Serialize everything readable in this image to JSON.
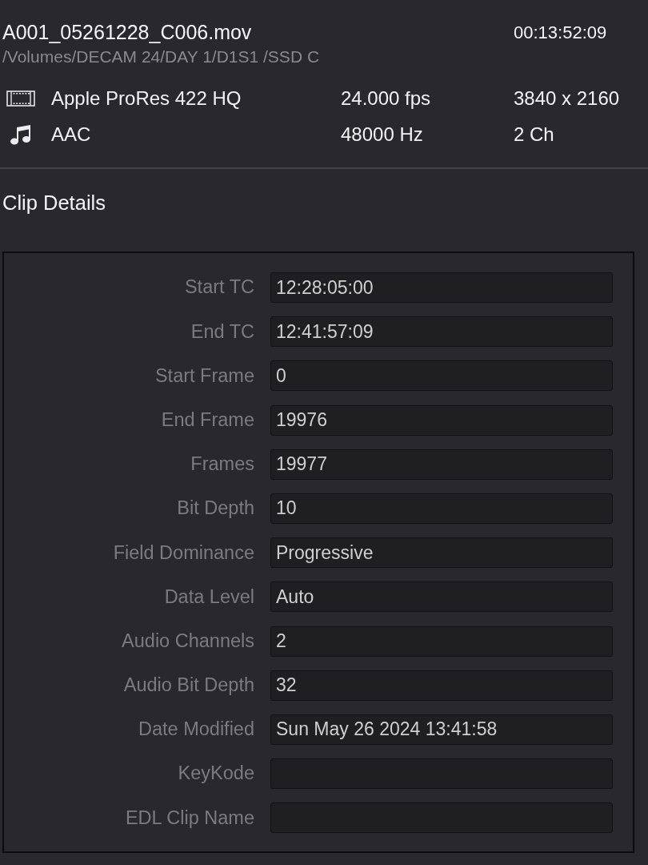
{
  "clip": {
    "filename": "A001_05261228_C006.mov",
    "duration": "00:13:52:09",
    "path": "/Volumes/DECAM 24/DAY 1/D1S1 /SSD C"
  },
  "streams": [
    {
      "kind": "video",
      "codec": "Apple ProRes 422 HQ",
      "rate": "24.000 fps",
      "format": "3840 x 2160"
    },
    {
      "kind": "audio",
      "codec": "AAC",
      "rate": "48000 Hz",
      "format": "2 Ch"
    }
  ],
  "clip_details": {
    "title": "Clip Details",
    "fields": [
      {
        "label": "Start TC",
        "value": "12:28:05:00"
      },
      {
        "label": "End TC",
        "value": "12:41:57:09"
      },
      {
        "label": "Start Frame",
        "value": "0"
      },
      {
        "label": "End Frame",
        "value": "19976"
      },
      {
        "label": "Frames",
        "value": "19977"
      },
      {
        "label": "Bit Depth",
        "value": "10"
      },
      {
        "label": "Field Dominance",
        "value": "Progressive"
      },
      {
        "label": "Data Level",
        "value": "Auto"
      },
      {
        "label": "Audio Channels",
        "value": "2"
      },
      {
        "label": "Audio Bit Depth",
        "value": "32"
      },
      {
        "label": "Date Modified",
        "value": "Sun May 26 2024 13:41:58"
      },
      {
        "label": "KeyKode"
      },
      {
        "label": "EDL Clip Name"
      }
    ]
  }
}
